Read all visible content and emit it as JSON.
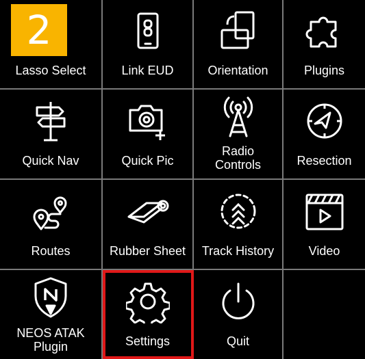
{
  "step_badge": "2",
  "tiles": [
    {
      "label": "Lasso Select",
      "icon": "lasso-select-icon"
    },
    {
      "label": "Link EUD",
      "icon": "link-eud-icon"
    },
    {
      "label": "Orientation",
      "icon": "orientation-icon"
    },
    {
      "label": "Plugins",
      "icon": "puzzle-piece-icon"
    },
    {
      "label": "Quick Nav",
      "icon": "signpost-icon"
    },
    {
      "label": "Quick Pic",
      "icon": "camera-plus-icon"
    },
    {
      "label": "Radio\nControls",
      "icon": "radio-tower-icon"
    },
    {
      "label": "Resection",
      "icon": "compass-icon"
    },
    {
      "label": "Routes",
      "icon": "route-icon"
    },
    {
      "label": "Rubber Sheet",
      "icon": "rubber-sheet-icon"
    },
    {
      "label": "Track History",
      "icon": "track-history-icon"
    },
    {
      "label": "Video",
      "icon": "video-clapper-icon"
    },
    {
      "label": "NEOS ATAK\nPlugin",
      "icon": "neos-shield-icon"
    },
    {
      "label": "Settings",
      "icon": "gear-icon"
    },
    {
      "label": "Quit",
      "icon": "power-icon"
    }
  ],
  "selected_tile": "Settings",
  "colors": {
    "background": "#000000",
    "grid_lines": "#7a7a7a",
    "highlight": "#e01818",
    "badge": "#f9b400"
  }
}
